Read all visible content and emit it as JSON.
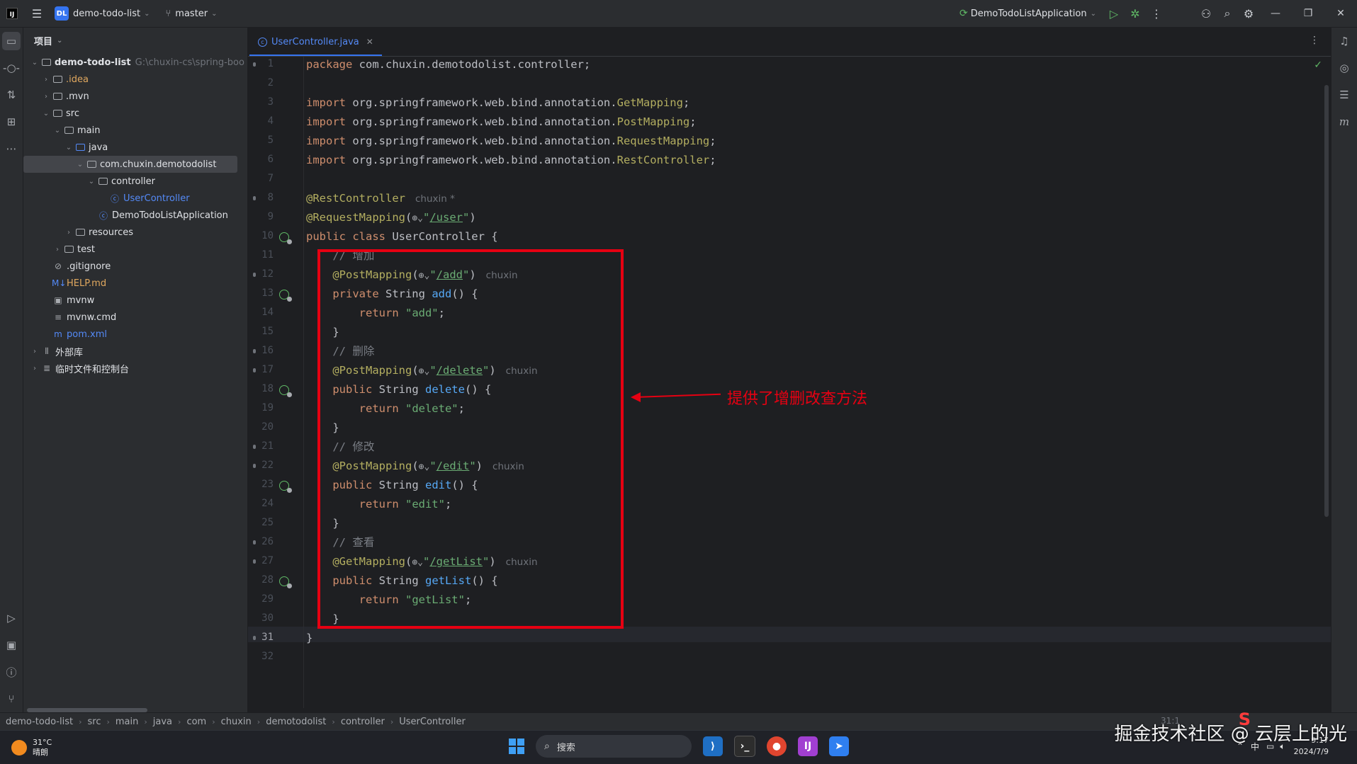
{
  "titlebar": {
    "project_badge": "DL",
    "project_name": "demo-todo-list",
    "branch": "master",
    "run_config": "DemoTodoListApplication"
  },
  "project_panel": {
    "title": "项目",
    "tree": [
      {
        "label": "demo-todo-list",
        "suffix": "G:\\chuxin-cs\\spring-boo",
        "depth": 0,
        "expanded": true,
        "icon": "folder-icon",
        "bold": true
      },
      {
        "label": ".idea",
        "depth": 1,
        "expanded": false,
        "icon": "folder-icon",
        "color": "orange"
      },
      {
        "label": ".mvn",
        "depth": 1,
        "expanded": false,
        "icon": "folder-icon"
      },
      {
        "label": "src",
        "depth": 1,
        "expanded": true,
        "icon": "folder-icon"
      },
      {
        "label": "main",
        "depth": 2,
        "expanded": true,
        "icon": "folder-icon"
      },
      {
        "label": "java",
        "depth": 3,
        "expanded": true,
        "icon": "folder-icon",
        "blue_folder": true
      },
      {
        "label": "com.chuxin.demotodolist",
        "depth": 4,
        "expanded": true,
        "icon": "package-icon",
        "selected": true
      },
      {
        "label": "controller",
        "depth": 5,
        "expanded": true,
        "icon": "package-icon"
      },
      {
        "label": "UserController",
        "depth": 6,
        "icon": "class-icon",
        "color": "blue"
      },
      {
        "label": "DemoTodoListApplication",
        "depth": 5,
        "icon": "spring-class-icon"
      },
      {
        "label": "resources",
        "depth": 3,
        "expanded": false,
        "icon": "folder-icon"
      },
      {
        "label": "test",
        "depth": 2,
        "expanded": false,
        "icon": "folder-icon"
      },
      {
        "label": ".gitignore",
        "depth": 1,
        "icon": "gitignore-icon"
      },
      {
        "label": "HELP.md",
        "depth": 1,
        "icon": "markdown-icon",
        "color": "orange"
      },
      {
        "label": "mvnw",
        "depth": 1,
        "icon": "terminal-file-icon"
      },
      {
        "label": "mvnw.cmd",
        "depth": 1,
        "icon": "text-file-icon"
      },
      {
        "label": "pom.xml",
        "depth": 1,
        "icon": "maven-icon",
        "color": "blue"
      },
      {
        "label": "外部库",
        "depth": 0,
        "expanded": false,
        "icon": "library-icon"
      },
      {
        "label": "临时文件和控制台",
        "depth": 0,
        "expanded": false,
        "icon": "scratch-icon"
      }
    ]
  },
  "editor": {
    "tab_label": "UserController.java",
    "current_line": "31",
    "lines": [
      {
        "n": "1",
        "parts": [
          [
            "kw",
            "package "
          ],
          [
            "imp",
            "com.chuxin.demotodolist.controller;"
          ]
        ]
      },
      {
        "n": "2",
        "parts": []
      },
      {
        "n": "3",
        "parts": [
          [
            "kw",
            "import "
          ],
          [
            "imp",
            "org.springframework.web.bind.annotation."
          ],
          [
            "imp-cls",
            "GetMapping"
          ],
          [
            "imp",
            ";"
          ]
        ]
      },
      {
        "n": "4",
        "parts": [
          [
            "kw",
            "import "
          ],
          [
            "imp",
            "org.springframework.web.bind.annotation."
          ],
          [
            "imp-cls",
            "PostMapping"
          ],
          [
            "imp",
            ";"
          ]
        ]
      },
      {
        "n": "5",
        "parts": [
          [
            "kw",
            "import "
          ],
          [
            "imp",
            "org.springframework.web.bind.annotation."
          ],
          [
            "imp-cls",
            "RequestMapping"
          ],
          [
            "imp",
            ";"
          ]
        ]
      },
      {
        "n": "6",
        "parts": [
          [
            "kw",
            "import "
          ],
          [
            "imp",
            "org.springframework.web.bind.annotation."
          ],
          [
            "imp-cls",
            "RestController"
          ],
          [
            "imp",
            ";"
          ]
        ]
      },
      {
        "n": "7",
        "parts": []
      },
      {
        "n": "8",
        "parts": [
          [
            "ann",
            "@RestController"
          ],
          [
            "author",
            "chuxin *"
          ]
        ]
      },
      {
        "n": "9",
        "parts": [
          [
            "ann",
            "@RequestMapping"
          ],
          [
            "imp",
            "("
          ],
          [
            "globe",
            "⊕⌄"
          ],
          [
            "str",
            "\""
          ],
          [
            "url",
            "/user"
          ],
          [
            "str",
            "\""
          ],
          [
            "imp",
            ")"
          ]
        ]
      },
      {
        "n": "10",
        "parts": [
          [
            "kw",
            "public class "
          ],
          [
            "imp",
            "UserController {"
          ]
        ]
      },
      {
        "n": "11",
        "parts": [
          [
            "cmt",
            "    // 增加"
          ]
        ]
      },
      {
        "n": "12",
        "parts": [
          [
            "ann",
            "    @PostMapping"
          ],
          [
            "imp",
            "("
          ],
          [
            "globe",
            "⊕⌄"
          ],
          [
            "str",
            "\""
          ],
          [
            "url",
            "/add"
          ],
          [
            "str",
            "\""
          ],
          [
            "imp",
            ")"
          ],
          [
            "author",
            "chuxin"
          ]
        ]
      },
      {
        "n": "13",
        "parts": [
          [
            "kw",
            "    private "
          ],
          [
            "imp",
            "String "
          ],
          [
            "fn",
            "add"
          ],
          [
            "imp",
            "() {"
          ]
        ]
      },
      {
        "n": "14",
        "parts": [
          [
            "kw",
            "        return "
          ],
          [
            "str",
            "\"add\""
          ],
          [
            "imp",
            ";"
          ]
        ]
      },
      {
        "n": "15",
        "parts": [
          [
            "imp",
            "    }"
          ]
        ]
      },
      {
        "n": "16",
        "parts": [
          [
            "cmt",
            "    // 删除"
          ]
        ]
      },
      {
        "n": "17",
        "parts": [
          [
            "ann",
            "    @PostMapping"
          ],
          [
            "imp",
            "("
          ],
          [
            "globe",
            "⊕⌄"
          ],
          [
            "str",
            "\""
          ],
          [
            "url",
            "/delete"
          ],
          [
            "str",
            "\""
          ],
          [
            "imp",
            ")"
          ],
          [
            "author",
            "chuxin"
          ]
        ]
      },
      {
        "n": "18",
        "parts": [
          [
            "kw",
            "    public "
          ],
          [
            "imp",
            "String "
          ],
          [
            "fn",
            "delete"
          ],
          [
            "imp",
            "() {"
          ]
        ]
      },
      {
        "n": "19",
        "parts": [
          [
            "kw",
            "        return "
          ],
          [
            "str",
            "\"delete\""
          ],
          [
            "imp",
            ";"
          ]
        ]
      },
      {
        "n": "20",
        "parts": [
          [
            "imp",
            "    }"
          ]
        ]
      },
      {
        "n": "21",
        "parts": [
          [
            "cmt",
            "    // 修改"
          ]
        ]
      },
      {
        "n": "22",
        "parts": [
          [
            "ann",
            "    @PostMapping"
          ],
          [
            "imp",
            "("
          ],
          [
            "globe",
            "⊕⌄"
          ],
          [
            "str",
            "\""
          ],
          [
            "url",
            "/edit"
          ],
          [
            "str",
            "\""
          ],
          [
            "imp",
            ")"
          ],
          [
            "author",
            "chuxin"
          ]
        ]
      },
      {
        "n": "23",
        "parts": [
          [
            "kw",
            "    public "
          ],
          [
            "imp",
            "String "
          ],
          [
            "fn",
            "edit"
          ],
          [
            "imp",
            "() {"
          ]
        ]
      },
      {
        "n": "24",
        "parts": [
          [
            "kw",
            "        return "
          ],
          [
            "str",
            "\"edit\""
          ],
          [
            "imp",
            ";"
          ]
        ]
      },
      {
        "n": "25",
        "parts": [
          [
            "imp",
            "    }"
          ]
        ]
      },
      {
        "n": "26",
        "parts": [
          [
            "cmt",
            "    // 查看"
          ]
        ]
      },
      {
        "n": "27",
        "parts": [
          [
            "ann",
            "    @GetMapping"
          ],
          [
            "imp",
            "("
          ],
          [
            "globe",
            "⊕⌄"
          ],
          [
            "str",
            "\""
          ],
          [
            "url",
            "/getList"
          ],
          [
            "str",
            "\""
          ],
          [
            "imp",
            ")"
          ],
          [
            "author",
            "chuxin"
          ]
        ]
      },
      {
        "n": "28",
        "parts": [
          [
            "kw",
            "    public "
          ],
          [
            "imp",
            "String "
          ],
          [
            "fn",
            "getList"
          ],
          [
            "imp",
            "() {"
          ]
        ]
      },
      {
        "n": "29",
        "parts": [
          [
            "kw",
            "        return "
          ],
          [
            "str",
            "\"getList\""
          ],
          [
            "imp",
            ";"
          ]
        ]
      },
      {
        "n": "30",
        "parts": [
          [
            "imp",
            "    }"
          ]
        ]
      },
      {
        "n": "31",
        "parts": [
          [
            "imp",
            "}"
          ]
        ]
      },
      {
        "n": "32",
        "parts": []
      }
    ],
    "gutter_icon_lines": [
      "10",
      "13",
      "18",
      "23",
      "28"
    ],
    "annotation_text": "提供了增删改查方法",
    "annotation_color": "#e60012"
  },
  "statusbar": {
    "breadcrumbs": [
      "demo-todo-list",
      "src",
      "main",
      "java",
      "com",
      "chuxin",
      "demotodolist",
      "controller",
      "UserController"
    ],
    "position": "31:1"
  },
  "taskbar": {
    "temperature": "31°C",
    "weather": "晴朗",
    "search_placeholder": "搜索",
    "time": "9:17",
    "date": "2024/7/9",
    "ime": "中"
  },
  "watermark": "掘金技术社区 @ 云层上的光"
}
